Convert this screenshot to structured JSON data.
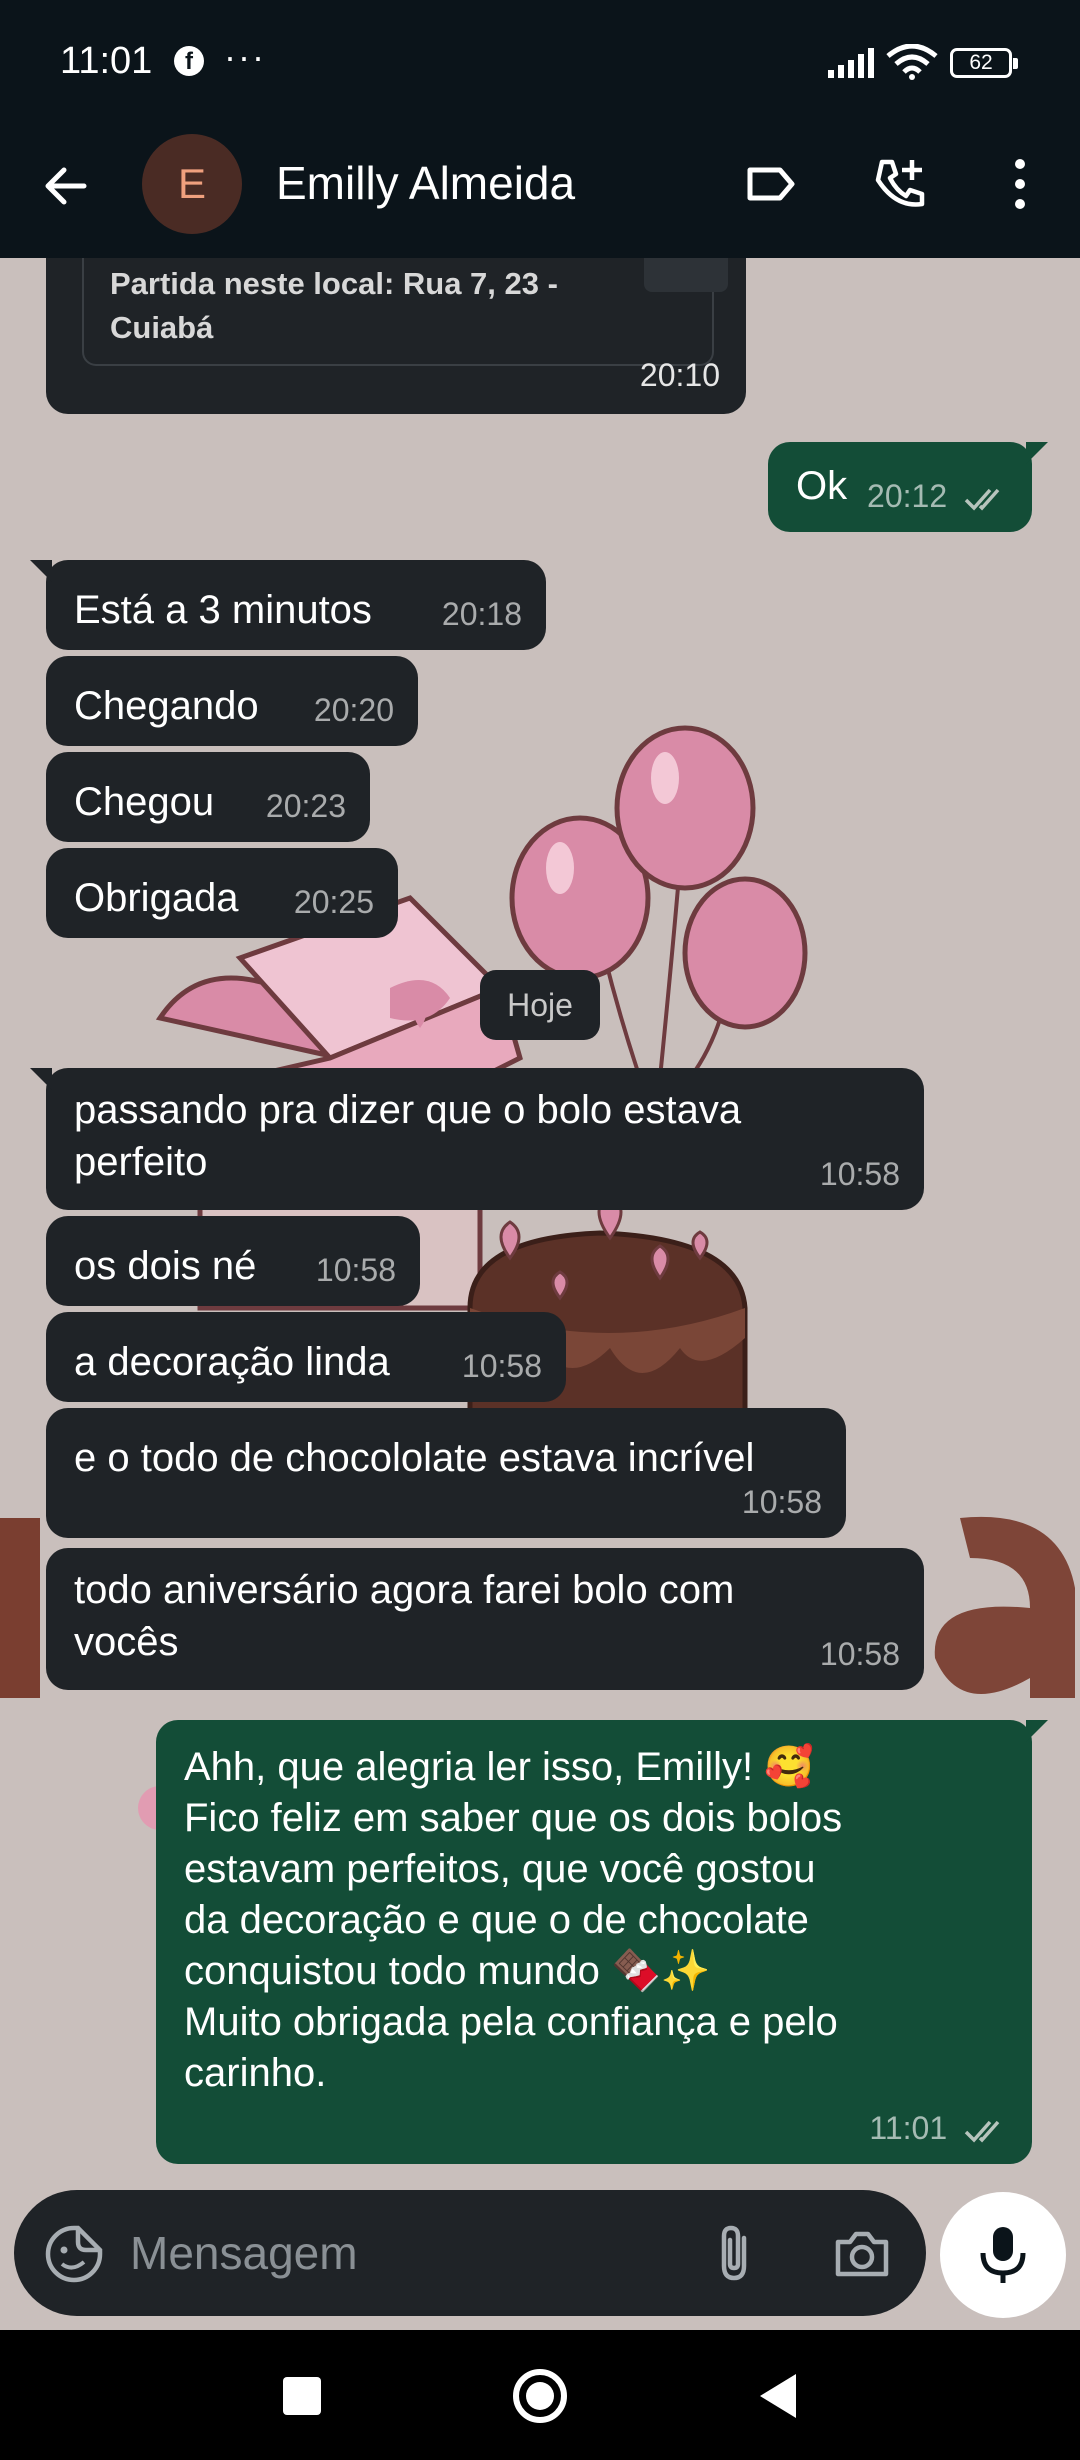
{
  "status_bar": {
    "time": "11:01",
    "notification_icon": "facebook-icon",
    "more_dots": "···",
    "battery": "62"
  },
  "header": {
    "avatar_letter": "E",
    "contact_name": "Emilly Almeida",
    "icons": [
      "back-arrow-icon",
      "label-icon",
      "add-call-icon",
      "more-vertical-icon"
    ]
  },
  "location_card": {
    "text": "Partida neste local: Rua 7, 23 - Cuiabá",
    "time": "20:10"
  },
  "messages_before": [
    {
      "direction": "out",
      "text": "Ok",
      "time": "20:12"
    },
    {
      "direction": "in",
      "text": "Está a 3 minutos",
      "time": "20:18"
    },
    {
      "direction": "in",
      "text": "Chegando",
      "time": "20:20"
    },
    {
      "direction": "in",
      "text": "Chegou",
      "time": "20:23"
    },
    {
      "direction": "in",
      "text": "Obrigada",
      "time": "20:25"
    }
  ],
  "date_separator": "Hoje",
  "messages_today": [
    {
      "direction": "in",
      "text": "passando pra dizer que o bolo estava perfeito",
      "line1": "passando pra dizer que o bolo estava",
      "line2": "perfeito",
      "time": "10:58"
    },
    {
      "direction": "in",
      "text": "os dois né",
      "time": "10:58"
    },
    {
      "direction": "in",
      "text": "a decoração linda",
      "time": "10:58"
    },
    {
      "direction": "in",
      "text": "e o todo de chocololate estava incrível",
      "time": "10:58"
    },
    {
      "direction": "in",
      "text": "todo aniversário agora farei bolo com vocês",
      "line1": "todo aniversário agora farei bolo com",
      "line2": "vocês",
      "time": "10:58"
    }
  ],
  "reply": {
    "direction": "out",
    "lines": [
      "Ahh, que alegria ler isso, Emilly! 🥰",
      "Fico feliz em saber que os dois bolos",
      "estavam perfeitos, que você gostou",
      "da decoração e que o de chocolate",
      "conquistou todo mundo 🍫✨",
      "Muito obrigada pela confiança e pelo",
      "carinho."
    ],
    "time": "11:01"
  },
  "input_bar": {
    "placeholder": "Mensagem",
    "icons": [
      "sticker-emoji-icon",
      "attach-icon",
      "camera-icon",
      "mic-icon"
    ]
  },
  "colors": {
    "incoming_bubble": "#1f2327",
    "outgoing_bubble": "#134d37",
    "header_bg": "#0b141a",
    "wallpaper_bg": "#c9bfbc",
    "read_ticks": "#b7c4bd"
  }
}
